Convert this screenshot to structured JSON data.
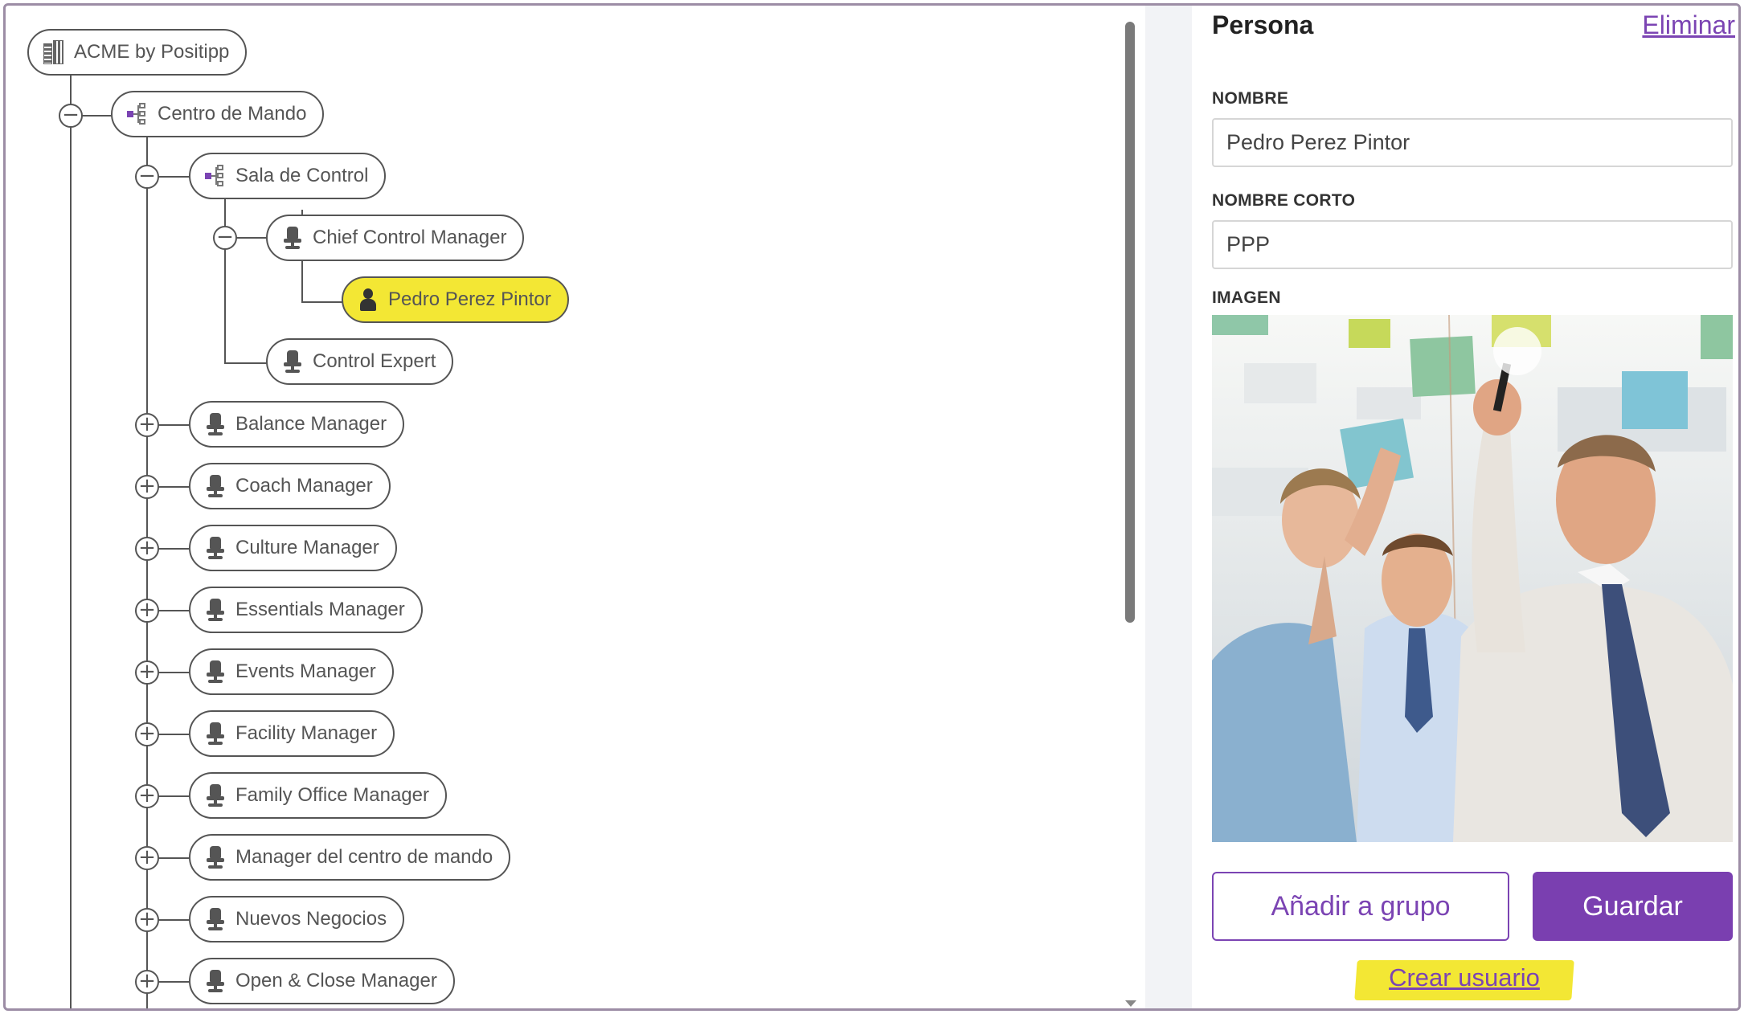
{
  "tree": {
    "root": {
      "label": "ACME by Positipp",
      "icon": "building-icon"
    },
    "level1": {
      "label": "Centro de Mando",
      "icon": "org-chart-icon"
    },
    "level2": {
      "label": "Sala de Control",
      "icon": "org-chart-icon"
    },
    "level3": [
      {
        "label": "Chief Control Manager",
        "icon": "chair-icon"
      },
      {
        "label": "Control Expert",
        "icon": "chair-icon"
      }
    ],
    "level4": {
      "label": "Pedro Perez Pintor",
      "icon": "person-icon",
      "selected": true
    },
    "positions": [
      {
        "label": "Balance Manager"
      },
      {
        "label": "Coach Manager"
      },
      {
        "label": "Culture Manager"
      },
      {
        "label": "Essentials Manager"
      },
      {
        "label": "Events Manager"
      },
      {
        "label": "Facility Manager"
      },
      {
        "label": "Family Office Manager"
      },
      {
        "label": "Manager del centro de mando"
      },
      {
        "label": "Nuevos Negocios"
      },
      {
        "label": "Open & Close Manager"
      }
    ],
    "collapse_symbol": "−",
    "expand_symbol": "+"
  },
  "detail": {
    "title": "Persona",
    "delete_label": "Eliminar",
    "name_label": "NOMBRE",
    "name_value": "Pedro Perez Pintor",
    "short_name_label": "NOMBRE CORTO",
    "short_name_value": "PPP",
    "image_label": "IMAGEN",
    "add_group_label": "Añadir a grupo",
    "save_label": "Guardar",
    "create_user_label": "Crear usuario"
  },
  "colors": {
    "accent": "#7b44b3",
    "highlight": "#f3e734",
    "line": "#555555"
  }
}
